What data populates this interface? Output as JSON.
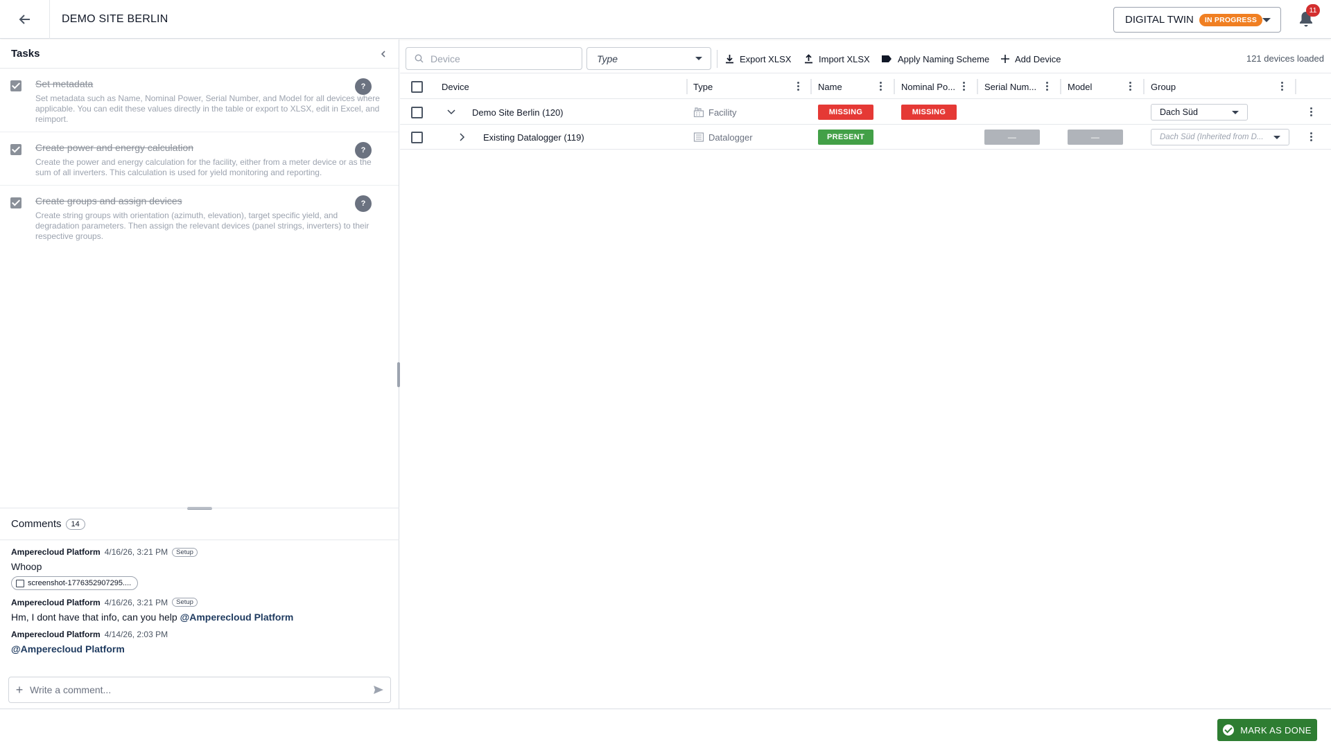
{
  "header": {
    "site_title": "DEMO SITE BERLIN",
    "module_label": "DIGITAL TWIN",
    "status_badge": "IN PROGRESS",
    "notification_count": "11"
  },
  "tasks": {
    "title": "Tasks",
    "items": [
      {
        "title": "Set metadata",
        "description": "Set metadata such as Name, Nominal Power, Serial Number, and Model for all devices where applicable. You can edit these values directly in the table or export to XLSX, edit in Excel, and reimport.",
        "done": true
      },
      {
        "title": "Create power and energy calculation",
        "description": "Create the power and energy calculation for the facility, either from a meter device or as the sum of all inverters. This calculation is used for yield monitoring and reporting.",
        "done": true
      },
      {
        "title": "Create groups and assign devices",
        "description": "Create string groups with orientation (azimuth, elevation), target specific yield, and degradation parameters. Then assign the relevant devices (panel strings, inverters) to their respective groups.",
        "done": true
      }
    ],
    "help_label": "?"
  },
  "comments": {
    "title": "Comments",
    "count": "14",
    "items": [
      {
        "author": "Amperecloud Platform",
        "time": "4/16/26, 3:21 PM",
        "tag": "Setup",
        "text": "Whoop",
        "attachment": "screenshot-1776352907295...."
      },
      {
        "author": "Amperecloud Platform",
        "time": "4/16/26, 3:21 PM",
        "tag": "Setup",
        "text": "Hm, I dont have that info, can you help ",
        "mention": "@Amperecloud Platform"
      },
      {
        "author": "Amperecloud Platform",
        "time": "4/14/26, 2:03 PM",
        "mention": "@Amperecloud Platform"
      }
    ],
    "input_placeholder": "Write a comment..."
  },
  "toolbar": {
    "search_placeholder": "Device",
    "type_placeholder": "Type",
    "export_label": "Export XLSX",
    "import_label": "Import XLSX",
    "naming_label": "Apply Naming Scheme",
    "add_label": "Add Device",
    "devices_loaded": "121 devices loaded"
  },
  "grid": {
    "columns": [
      "Device",
      "Type",
      "Name",
      "Nominal Po...",
      "Serial Num...",
      "Model",
      "Group"
    ],
    "rows": [
      {
        "device": "Demo Site Berlin (120)",
        "expanded": true,
        "type": "Facility",
        "type_icon": "facility-icon",
        "name_status": "MISSING",
        "nominal_status": "MISSING",
        "serial": "",
        "model": "",
        "group": "Dach Süd"
      },
      {
        "device": "Existing Datalogger (119)",
        "expanded": false,
        "type": "Datalogger",
        "type_icon": "datalogger-icon",
        "name_status": "PRESENT",
        "nominal_status": "",
        "serial": "—",
        "model": "—",
        "group": "Dach Süd (Inherited from D..."
      }
    ]
  },
  "footer": {
    "done_label": "MARK AS DONE"
  },
  "colors": {
    "missing": "#e53935",
    "present": "#43a047",
    "badge": "#f07f22",
    "done": "#2e7d32"
  }
}
